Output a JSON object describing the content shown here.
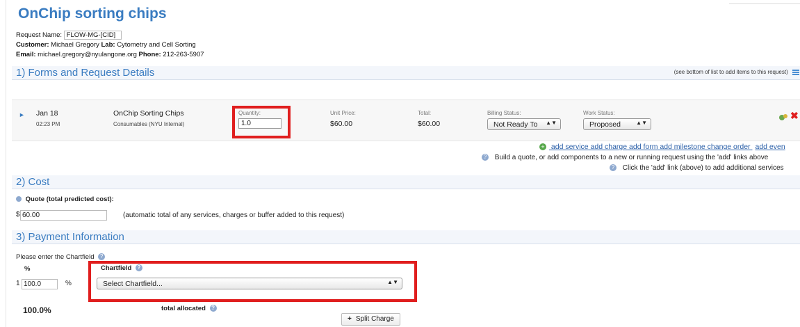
{
  "page": {
    "title": "OnChip sorting chips"
  },
  "request": {
    "name_label": "Request Name:",
    "name_value": "FLOW-MG-[CID]",
    "customer_label": "Customer:",
    "customer_value": "Michael Gregory",
    "lab_label": "Lab:",
    "lab_value": "Cytometry and Cell Sorting",
    "email_label": "Email:",
    "email_value": "michael.gregory@nyulangone.org",
    "phone_label": "Phone:",
    "phone_value": "212-263-5907"
  },
  "sections": {
    "forms": "1) Forms and Request Details",
    "forms_note": "(see bottom of list to add items to this request)",
    "cost": "2) Cost",
    "payment": "3) Payment Information"
  },
  "line_item": {
    "date": "Jan 18",
    "time": "02:23 PM",
    "name": "OnChip Sorting Chips",
    "category": "Consumables (NYU Internal)",
    "quantity_label": "Quantity:",
    "quantity_value": "1.0",
    "unit_price_label": "Unit Price:",
    "unit_price": "$60.00",
    "total_label": "Total:",
    "total": "$60.00",
    "billing_label": "Billing Status:",
    "billing_value": "Not Ready To",
    "work_label": "Work Status:",
    "work_value": "Proposed"
  },
  "actions": {
    "add_service": "add service",
    "add_charge": "add charge",
    "add_form": "add form",
    "add_milestone": "add milestone",
    "change_order": "change order",
    "add_event": "add even",
    "hint1": "Build a quote, or add components to a new or running request using the 'add' links above",
    "hint2": "Click the 'add' link (above) to add additional services"
  },
  "cost": {
    "quote_label": "Quote (total predicted cost):",
    "currency": "$",
    "quote_value": "60.00",
    "quote_note": "(automatic total of any services, charges or buffer added to this request)"
  },
  "payment": {
    "prompt": "Please enter the Chartfield",
    "percent_header": "%",
    "chartfield_header": "Chartfield",
    "row_index": "1",
    "percent_value": "100.0",
    "percent_suffix": "%",
    "chartfield_select": "Select Chartfield...",
    "total_percent": "100.0%",
    "total_label": "total allocated",
    "split_button": "Split Charge",
    "split_icon": "+"
  },
  "colors": {
    "accent": "#3a7cc1",
    "highlight_frame": "#e01e1e"
  }
}
